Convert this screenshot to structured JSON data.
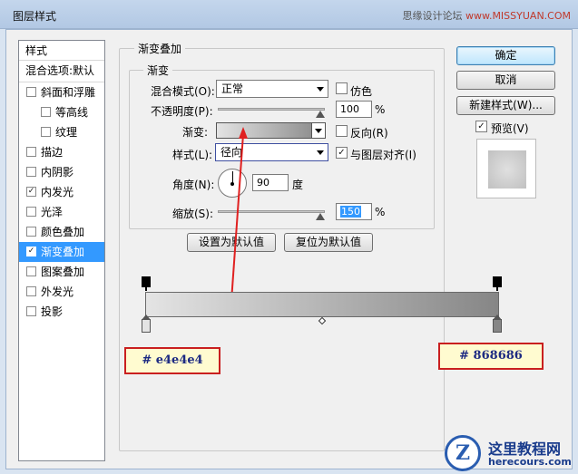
{
  "window": {
    "title": "图层样式",
    "watermark_left": "思缘设计论坛",
    "watermark_right": "www.MISSYUAN.COM"
  },
  "sidebar": {
    "header": "样式",
    "blend_options": "混合选项:默认",
    "items": [
      {
        "label": "斜面和浮雕",
        "checked": false,
        "indent": false
      },
      {
        "label": "等高线",
        "checked": false,
        "indent": true
      },
      {
        "label": "纹理",
        "checked": false,
        "indent": true
      },
      {
        "label": "描边",
        "checked": false,
        "indent": false
      },
      {
        "label": "内阴影",
        "checked": false,
        "indent": false
      },
      {
        "label": "内发光",
        "checked": true,
        "indent": false
      },
      {
        "label": "光泽",
        "checked": false,
        "indent": false
      },
      {
        "label": "颜色叠加",
        "checked": false,
        "indent": false
      },
      {
        "label": "渐变叠加",
        "checked": true,
        "indent": false,
        "selected": true
      },
      {
        "label": "图案叠加",
        "checked": false,
        "indent": false
      },
      {
        "label": "外发光",
        "checked": false,
        "indent": false
      },
      {
        "label": "投影",
        "checked": false,
        "indent": false
      }
    ]
  },
  "panel": {
    "group_title": "渐变叠加",
    "subgroup_title": "渐变",
    "blend_mode_label": "混合模式(O):",
    "blend_mode_value": "正常",
    "dither_label": "仿色",
    "dither_checked": false,
    "opacity_label": "不透明度(P):",
    "opacity_value": "100",
    "opacity_unit": "%",
    "opacity_percent": 100,
    "gradient_label": "渐变:",
    "reverse_label": "反向(R)",
    "reverse_checked": false,
    "style_label": "样式(L):",
    "style_value": "径向",
    "align_label": "与图层对齐(I)",
    "align_checked": true,
    "angle_label": "角度(N):",
    "angle_value": "90",
    "angle_unit": "度",
    "scale_label": "缩放(S):",
    "scale_value": "150",
    "scale_unit": "%",
    "set_default": "设置为默认值",
    "reset_default": "复位为默认值"
  },
  "buttons": {
    "ok": "确定",
    "cancel": "取消",
    "new_style": "新建样式(W)...",
    "preview_label": "预览(V)",
    "preview_checked": true
  },
  "gradient_editor": {
    "start_color": "#e4e4e4",
    "end_color": "#868686",
    "start_label": "# e4e4e4",
    "end_label": "# 868686"
  },
  "site_logo": {
    "cn": "这里教程网",
    "url": "herecours.com"
  }
}
